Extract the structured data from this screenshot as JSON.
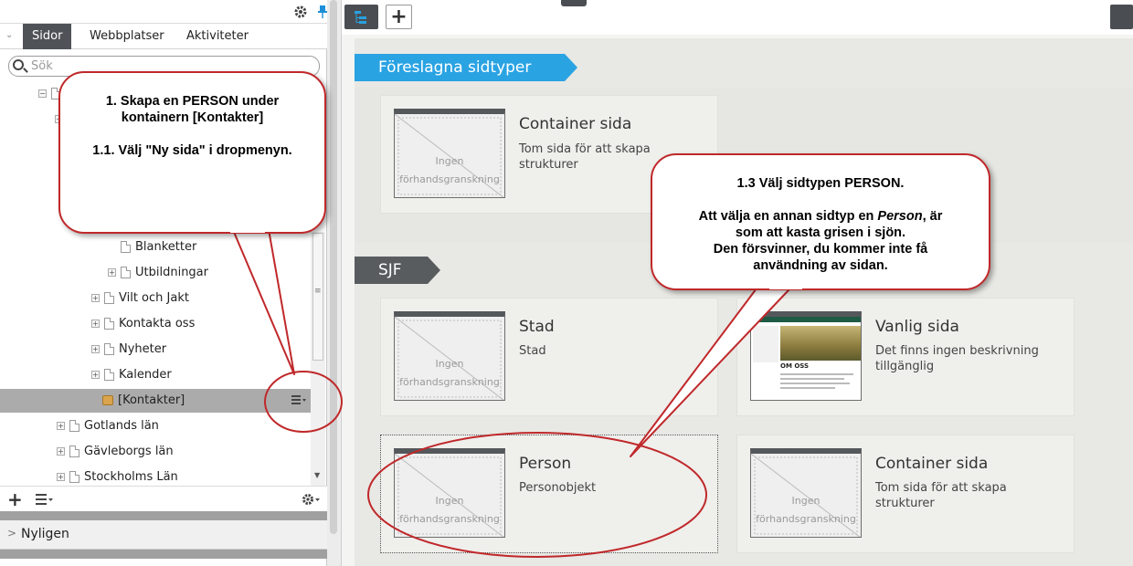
{
  "left_pane": {
    "tabs": [
      "Sidor",
      "Webbplatser",
      "Aktiviteter"
    ],
    "search_placeholder": "Sök",
    "tree": [
      {
        "label": "Blanketter",
        "expandable": false
      },
      {
        "label": "Utbildningar",
        "expandable": true
      },
      {
        "label": "Vilt och Jakt",
        "expandable": true
      },
      {
        "label": "Kontakta oss",
        "expandable": true
      },
      {
        "label": "Nyheter",
        "expandable": true
      },
      {
        "label": "Kalender",
        "expandable": true
      },
      {
        "label": "[Kontakter]",
        "expandable": false,
        "selected": true
      },
      {
        "label": "Gotlands län",
        "expandable": true
      },
      {
        "label": "Gävleborgs län",
        "expandable": true
      },
      {
        "label": "Stockholms Län",
        "expandable": true
      }
    ],
    "recent_label": "Nyligen"
  },
  "right_pane": {
    "groups": [
      {
        "title": "Föreslagna sidtyper",
        "color": "#2aa3e3",
        "cards": [
          {
            "title": "Container sida",
            "desc": "Tom sida för att skapa strukturer",
            "preview": "Ingen förhandsgranskning"
          }
        ]
      },
      {
        "title": "SJF",
        "color": "#595c5f",
        "cards": [
          {
            "title": "Stad",
            "desc": "Stad",
            "preview": "Ingen förhandsgranskning"
          },
          {
            "title": "Vanlig sida",
            "desc": "Det finns ingen beskrivning tillgänglig",
            "preview_image": true
          },
          {
            "title": "Person",
            "desc": "Personobjekt",
            "preview": "Ingen förhandsgranskning"
          },
          {
            "title": "Container sida",
            "desc": "Tom sida för att skapa strukturer",
            "preview": "Ingen förhandsgranskning"
          }
        ]
      }
    ]
  },
  "callouts": {
    "left": [
      "1. Skapa en PERSON under",
      "kontainern [Kontakter]",
      "",
      "1.1. Välj \"Ny sida\" i dropmenyn."
    ],
    "right": {
      "line1": "1.3 Välj sidtypen PERSON.",
      "line2a": "Att välja en annan sidtyp en ",
      "line2b": "Person",
      "line2c": ", är",
      "line3": "som att kasta grisen i sjön.",
      "line4": "Den försvinner, du kommer inte få",
      "line5": "användning av sidan."
    }
  },
  "preview_image_text": "OM OSS",
  "icons": [
    "gear-icon",
    "pin-icon",
    "tree-view-icon",
    "add-icon",
    "search-icon",
    "context-menu-icon",
    "document-icon",
    "container-icon"
  ]
}
